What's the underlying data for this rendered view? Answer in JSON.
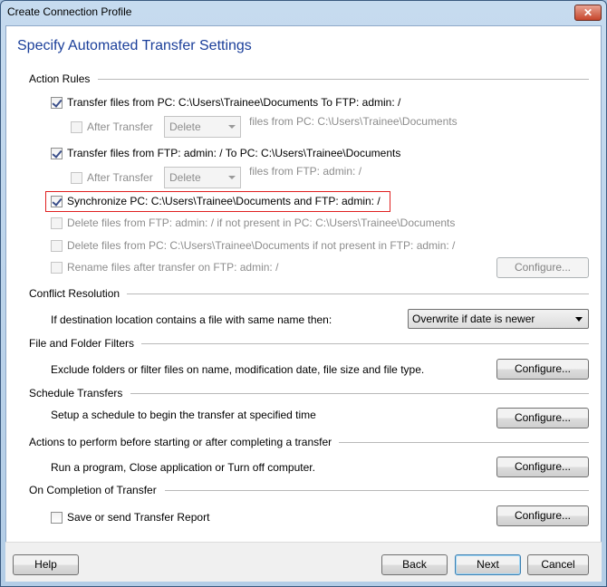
{
  "window": {
    "title": "Create Connection Profile",
    "close_icon": "close-icon"
  },
  "heading": "Specify Automated Transfer Settings",
  "action_rules": {
    "title": "Action Rules",
    "transfer_pc_to_ftp": {
      "label": "Transfer files from PC: C:\\Users\\Trainee\\Documents  To  FTP: admin: /",
      "checked": true
    },
    "after_transfer_1": {
      "label": "After Transfer",
      "checked": false,
      "select": "Delete",
      "suffix": "files from PC: C:\\Users\\Trainee\\Documents"
    },
    "transfer_ftp_to_pc": {
      "label": "Transfer files from FTP: admin: /  To  PC: C:\\Users\\Trainee\\Documents",
      "checked": true
    },
    "after_transfer_2": {
      "label": "After Transfer",
      "checked": false,
      "select": "Delete",
      "suffix": "files from FTP: admin: /"
    },
    "synchronize": {
      "label": "Synchronize PC: C:\\Users\\Trainee\\Documents and FTP: admin: /",
      "checked": true,
      "highlight_color": "#e02020"
    },
    "delete_ftp": {
      "label": "Delete files from FTP: admin: / if not present in PC: C:\\Users\\Trainee\\Documents",
      "checked": false
    },
    "delete_pc": {
      "label": "Delete files from PC: C:\\Users\\Trainee\\Documents if not present in FTP: admin: /",
      "checked": false
    },
    "rename": {
      "label": "Rename files after transfer on FTP: admin: /",
      "checked": false
    },
    "configure": "Configure..."
  },
  "conflict": {
    "title": "Conflict Resolution",
    "label": "If destination location contains a file with same name then:",
    "select": "Overwrite if date is newer"
  },
  "filters": {
    "title": "File and Folder Filters",
    "label": "Exclude folders or filter files on name, modification date, file size and file type.",
    "configure": "Configure..."
  },
  "schedule": {
    "title": "Schedule Transfers",
    "label": "Setup a schedule to begin the transfer at specified time",
    "configure": "Configure..."
  },
  "actions": {
    "title": "Actions to perform before starting or after completing a transfer",
    "label": "Run a program, Close application or Turn off computer.",
    "configure": "Configure..."
  },
  "completion": {
    "title": "On Completion of Transfer",
    "label": "Save or send Transfer Report",
    "checked": false,
    "configure": "Configure..."
  },
  "footer": {
    "help": "Help",
    "back": "Back",
    "next": "Next",
    "cancel": "Cancel"
  },
  "colors": {
    "heading": "#1b3f9a"
  }
}
